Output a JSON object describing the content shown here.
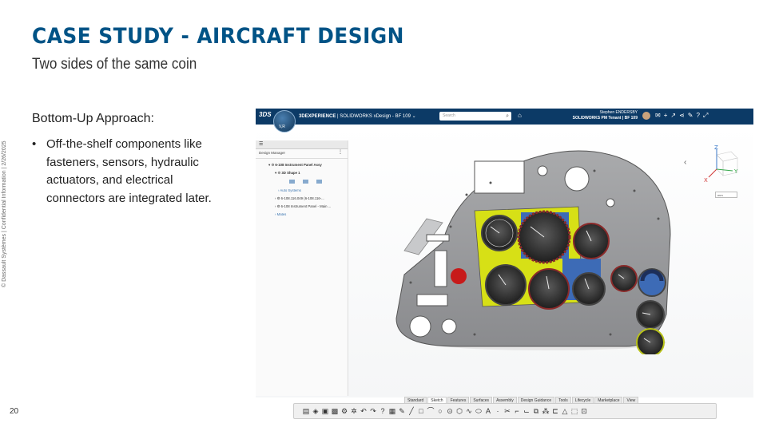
{
  "slide": {
    "title": "CASE STUDY - AIRCRAFT DESIGN",
    "subtitle": "Two sides of the same coin",
    "side_text": "© Dassault Systèmes | Confidential Information | 2/26/2025",
    "heading": "Bottom-Up Approach:",
    "bullet": "Off-the-shelf components like fasteners, sensors, hydraulic actuators, and electrical connectors are integrated later.",
    "page_number": "20",
    "title_color": "#005386"
  },
  "app": {
    "logo": "3DS",
    "compass_label": "V,R",
    "brand_bold": "3DEXPERIENCE",
    "brand_rest": " | SOLIDWORKS xDesign - BF 109 ⌄",
    "search_placeholder": "Search",
    "user_name": "Stephen ENDERSBY",
    "tenant": "SOLIDWORKS PM Tenant | BF 109",
    "top_icons": [
      "notification-icon",
      "add-icon",
      "share-icon",
      "network-icon",
      "tools-icon",
      "help-icon",
      "expand-icon"
    ],
    "design_manager": {
      "title": "Design Manager",
      "root": "6-108 Instrument Panel Assy",
      "shape": "3D Shape 1",
      "item_autosystems": "Auto Systems",
      "item_part1": "6-108.116.049 (6-108.116-...",
      "item_part2": "6-108 Instrument Panel - Main ...",
      "item_mates": "Mates"
    },
    "view_select": "mm",
    "tabs": [
      "Standard",
      "Sketch",
      "Features",
      "Surfaces",
      "Assembly",
      "Design Guidance",
      "Tools",
      "Lifecycle",
      "Marketplace",
      "View"
    ],
    "active_tab": "Sketch"
  }
}
